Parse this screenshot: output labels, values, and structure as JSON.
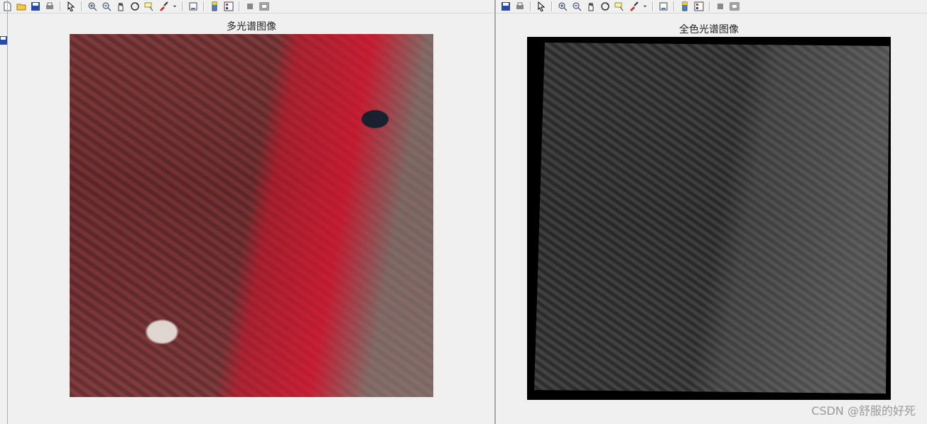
{
  "left_panel": {
    "title": "多光谱图像"
  },
  "right_panel": {
    "title": "全色光谱图像"
  },
  "watermark": "CSDN @舒服的好死",
  "left_toolbar_icons": [
    "new-file-icon",
    "open-folder-icon",
    "save-icon",
    "print-icon",
    "pointer-icon",
    "zoom-in-icon",
    "zoom-out-icon",
    "pan-hand-icon",
    "rotate-3d-icon",
    "data-cursor-icon",
    "brush-icon",
    "dropdown-arrow-icon",
    "link-plot-icon",
    "colorbar-icon",
    "legend-icon",
    "hide-plot-tools-icon",
    "show-plot-tools-icon"
  ],
  "right_toolbar_icons": [
    "save-icon",
    "print-icon",
    "pointer-icon",
    "zoom-in-icon",
    "zoom-out-icon",
    "pan-hand-icon",
    "rotate-3d-icon",
    "data-cursor-icon",
    "brush-icon",
    "dropdown-arrow-icon",
    "link-plot-icon",
    "colorbar-icon",
    "legend-icon",
    "hide-plot-tools-icon",
    "show-plot-tools-icon"
  ]
}
